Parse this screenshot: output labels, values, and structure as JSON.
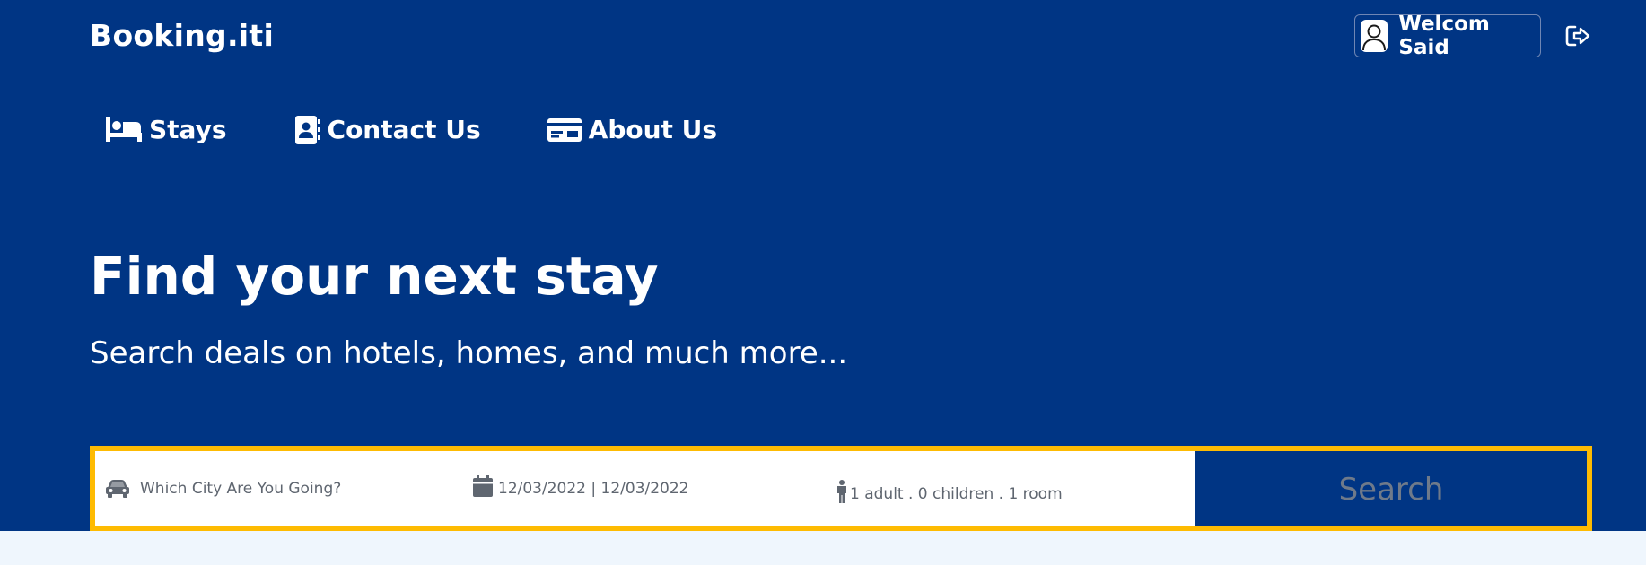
{
  "header": {
    "brand": "Booking.iti",
    "user_greeting": "Welcom Said",
    "icons": {
      "avatar": "user-avatar-icon",
      "logout": "logout-icon"
    }
  },
  "nav": {
    "items": [
      {
        "label": "Stays",
        "icon": "bed-icon"
      },
      {
        "label": "Contact Us",
        "icon": "contact-book-icon"
      },
      {
        "label": "About Us",
        "icon": "id-card-icon"
      }
    ]
  },
  "hero": {
    "title": "Find your next stay",
    "subtitle": "Search deals on hotels, homes, and much more..."
  },
  "search": {
    "destination_placeholder": "Which City Are You Going?",
    "dates": "12/03/2022 | 12/03/2022",
    "guests": "1 adult . 0 children . 1 room",
    "button_label": "Search",
    "icons": {
      "destination": "car-icon",
      "dates": "calendar-icon",
      "guests": "person-icon"
    }
  },
  "colors": {
    "primary": "#003584",
    "accent": "#febb02",
    "page_background": "#eff6fd",
    "field_text": "#5f6670"
  }
}
